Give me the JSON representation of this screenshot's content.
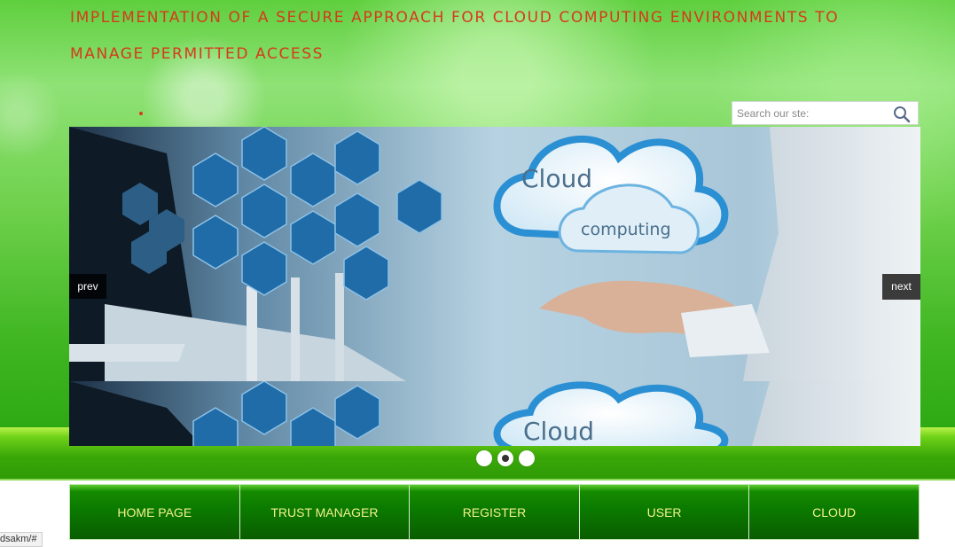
{
  "site": {
    "title": "IMPLEMENTATION OF A SECURE APPROACH FOR CLOUD COMPUTING ENVIRONMENTS TO MANAGE PERMITTED ACCESS"
  },
  "search": {
    "placeholder": "Search our ste:",
    "value": ""
  },
  "slider": {
    "prev_label": "prev",
    "next_label": "next",
    "slide_text_1": "Cloud",
    "slide_text_2": "computing",
    "dots": 3,
    "active_dot": 2
  },
  "menu": {
    "items": [
      {
        "label": "HOME PAGE"
      },
      {
        "label": "TRUST MANAGER"
      },
      {
        "label": "REGISTER"
      },
      {
        "label": "USER"
      },
      {
        "label": "CLOUD"
      }
    ]
  },
  "status_bar": {
    "url": "dsakm/#"
  },
  "colors": {
    "title": "#d63a1a",
    "menu_text": "#f2f28c",
    "menu_bg": "#0b7a00",
    "page_green": "#6dd04a"
  },
  "icons": {
    "search": "magnifier-icon"
  }
}
